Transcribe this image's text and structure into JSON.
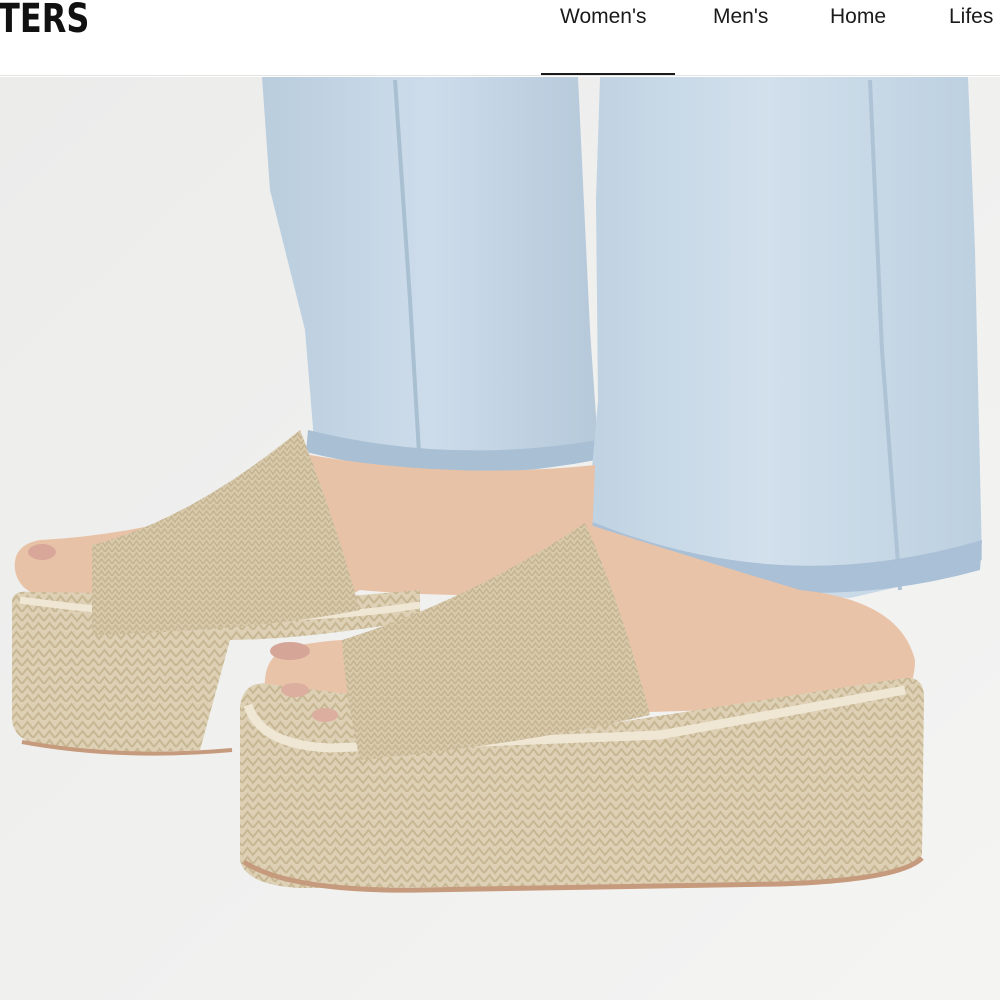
{
  "header": {
    "logo_text": "TERS",
    "nav": [
      {
        "label": "Women's",
        "active": true
      },
      {
        "label": "Men's",
        "active": false
      },
      {
        "label": "Home",
        "active": false
      },
      {
        "label": "Lifes",
        "active": false
      }
    ]
  },
  "product_image": {
    "icon": "product-photo",
    "colors": {
      "background": "#f1f1f0",
      "denim": "#c4d5e3",
      "jute": "#dccdb1",
      "skin": "#e9c3a8"
    }
  }
}
